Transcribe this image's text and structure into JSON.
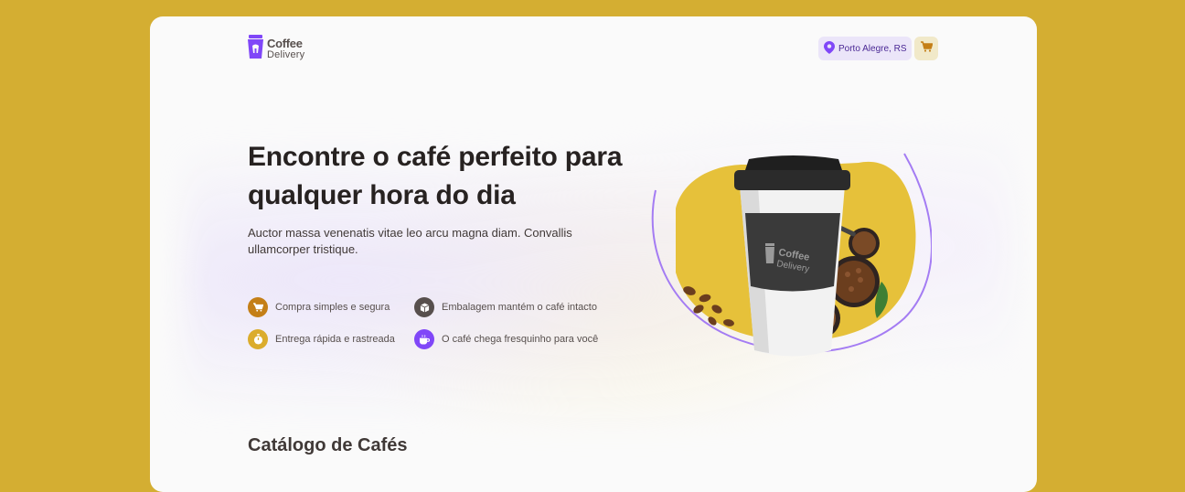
{
  "header": {
    "logo": {
      "line1": "Coffee",
      "line2": "Delivery",
      "icon": "coffee-cup-logo-icon"
    },
    "location": {
      "label": "Porto Alegre, RS",
      "icon": "map-pin-icon"
    },
    "cart": {
      "icon": "shopping-cart-icon"
    }
  },
  "hero": {
    "title": "Encontre o café perfeito para qualquer hora do dia",
    "subtitle": "Auctor massa venenatis vitae leo arcu magna diam. Convallis ullamcorper tristique.",
    "features": [
      {
        "label": "Compra simples e segura",
        "icon": "shopping-cart-icon",
        "color": "#C47F17"
      },
      {
        "label": "Embalagem mantém o café intacto",
        "icon": "package-icon",
        "color": "#574F4D"
      },
      {
        "label": "Entrega rápida e rastreada",
        "icon": "timer-icon",
        "color": "#DBAC2C"
      },
      {
        "label": "O café chega fresquinho para você",
        "icon": "coffee-icon",
        "color": "#8047F8"
      }
    ],
    "image": {
      "cup_text_line1": "Coffee",
      "cup_text_line2": "Delivery"
    }
  },
  "catalog": {
    "title": "Catálogo de Cafés"
  },
  "colors": {
    "background": "#D4AE32",
    "card": "#FAFAFA",
    "purple": "#8047F8",
    "purple_light": "#EBE5F9",
    "yellow": "#DBAC2C",
    "yellow_dark": "#C47F17",
    "yellow_light": "#F1E9C9"
  }
}
